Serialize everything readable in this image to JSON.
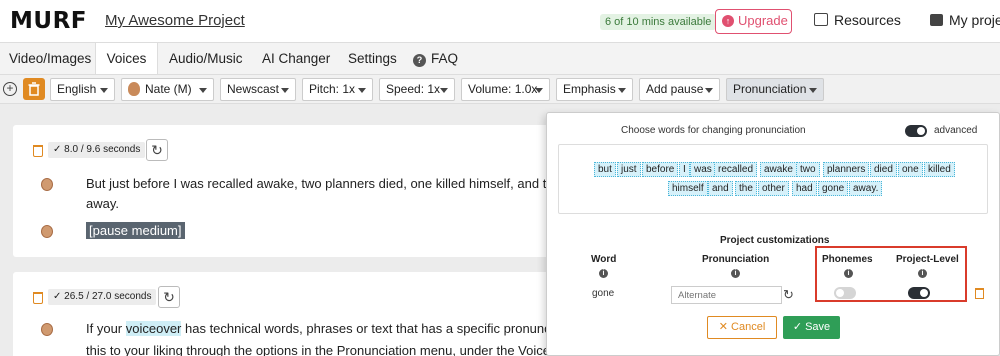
{
  "app": {
    "logo": "MURF",
    "project_title": "My Awesome Project",
    "mins_available": "6 of 10 mins available",
    "upgrade_label": "Upgrade",
    "resources_label": "Resources",
    "my_projects_label": "My proje"
  },
  "tabs": {
    "video_images": "Video/Images",
    "voices": "Voices",
    "background_music": "Audio/Music",
    "ai_changer": "AI Changer",
    "settings": "Settings",
    "faq": "FAQ"
  },
  "toolbar": {
    "language": "English",
    "voice": "Nate (M)",
    "style": "Newscast",
    "pitch": "Pitch: 1x",
    "speed": "Speed: 1x",
    "volume": "Volume: 1.0x",
    "emphasis": "Emphasis",
    "add_pause": "Add pause",
    "pronunciation": "Pronunciation"
  },
  "blocks": [
    {
      "duration": "8.0 / 9.6 seconds",
      "line1": "But just before I was recalled awake, two planners died, one killed himself, and the oth",
      "line1_cont": "away.",
      "pause": "[pause medium]"
    },
    {
      "duration": "26.5 / 27.0 seconds",
      "line1_pre": "If your ",
      "line1_highlight": "voiceover",
      "line1_post": " has technical words, phrases or text that has a specific pronunciatio",
      "line2": "this to your liking through the options in the Pronunciation menu, under the Voices ta"
    }
  ],
  "pronunciation_panel": {
    "title": "Choose words for changing pronunciation",
    "advanced_label": "advanced",
    "advanced_on": true,
    "words_row1": [
      "but",
      "just",
      "before",
      "I",
      "was",
      "recalled",
      "awake",
      "two",
      "planners",
      "died",
      "one",
      "killed"
    ],
    "words_row2": [
      "himself",
      "and",
      "the",
      "other",
      "had",
      "gone",
      "away."
    ],
    "customizations_title": "Project customizations",
    "col_word": "Word",
    "col_pronunciation": "Pronunciation",
    "col_phonemes": "Phonemes",
    "col_project_level": "Project-Level",
    "row_word": "gone",
    "alternate_placeholder": "Alternate",
    "phonemes_on": false,
    "project_level_on": true,
    "cancel_label": "Cancel",
    "save_label": "Save"
  },
  "colors": {
    "accent_orange": "#e08a22",
    "upgrade_pink": "#e05070",
    "save_green": "#2f9e57",
    "highlight_red": "#d93b2b",
    "chip_blue": "#d6f1fa"
  }
}
